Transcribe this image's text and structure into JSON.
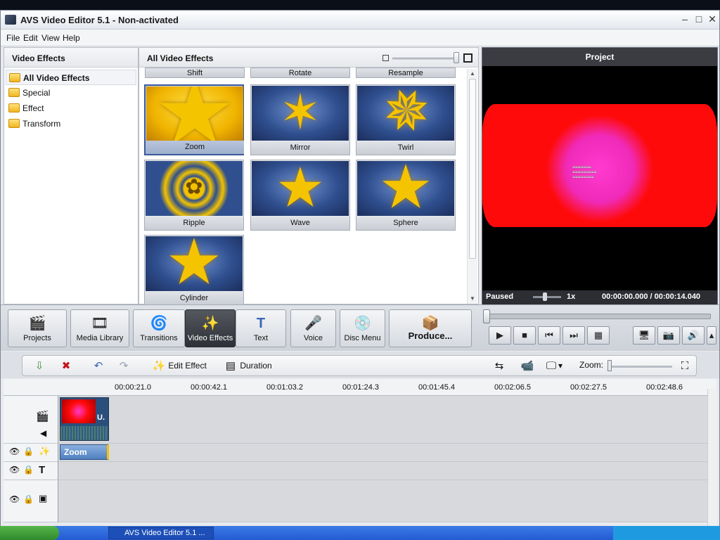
{
  "window": {
    "title": "AVS Video Editor 5.1 - Non-activated"
  },
  "menu": [
    "File",
    "Edit",
    "View",
    "Help"
  ],
  "left_panel": {
    "title": "Video Effects",
    "items": [
      "All Video Effects",
      "Special",
      "Effect",
      "Transform"
    ]
  },
  "effects_panel": {
    "title": "All Video Effects",
    "cut_top": [
      "Shift",
      "Rotate",
      "Resample"
    ],
    "tiles": [
      "Zoom",
      "Mirror",
      "Twirl",
      "Ripple",
      "Wave",
      "Sphere",
      "Cylinder"
    ],
    "selected": "Zoom"
  },
  "preview": {
    "title": "Project",
    "status": "Paused",
    "speed": "1x",
    "time": "00:00:00.000 / 00:00:14.040"
  },
  "toolbar": {
    "buttons": [
      "Projects",
      "Media Library",
      "Transitions",
      "Video Effects",
      "Text",
      "Voice",
      "Disc Menu",
      "Produce..."
    ],
    "active": "Video Effects"
  },
  "timeline": {
    "edit_effect": "Edit Effect",
    "duration": "Duration",
    "zoom_label": "Zoom:",
    "ruler": [
      "00:00:21.0",
      "00:00:42.1",
      "00:01:03.2",
      "00:01:24.3",
      "00:01:45.4",
      "00:02:06.5",
      "00:02:27.5",
      "00:02:48.6"
    ],
    "clip_label": "U.",
    "effect_clip": "Zoom"
  },
  "taskbar": {
    "item": "AVS Video Editor 5.1 ..."
  },
  "colors": {
    "accent": "#3b5a9c",
    "star": "#f5c400",
    "preview_red": "#ff0a0a",
    "preview_pink": "#ff3ad0"
  }
}
